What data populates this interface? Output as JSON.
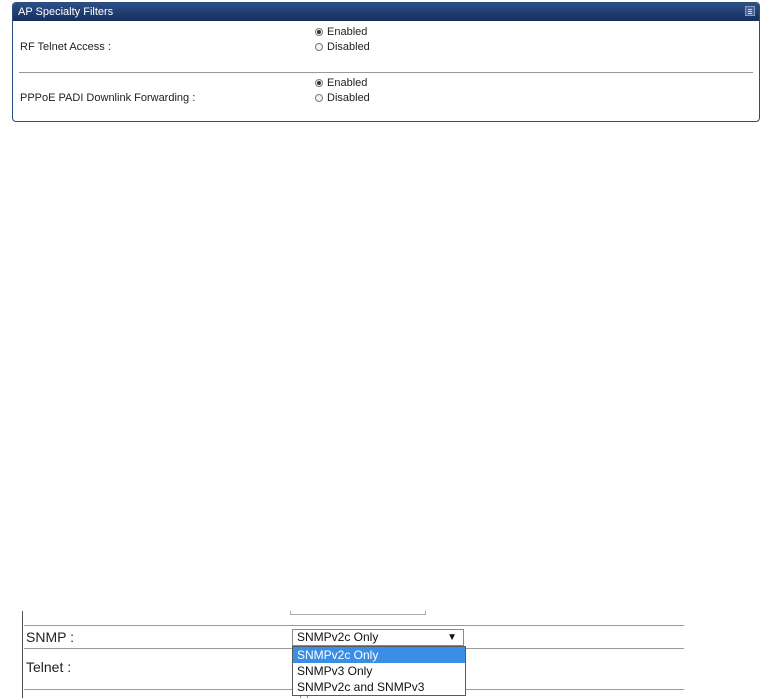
{
  "panel": {
    "title": "AP Specialty Filters",
    "rows": [
      {
        "label": "RF Telnet Access :",
        "options": [
          "Enabled",
          "Disabled"
        ],
        "selected": "Enabled"
      },
      {
        "label": "PPPoE PADI Downlink Forwarding :",
        "options": [
          "Enabled",
          "Disabled"
        ],
        "selected": "Enabled"
      }
    ]
  },
  "snmp_section": {
    "snmp_label": "SNMP :",
    "telnet_label": "Telnet :",
    "select_value": "SNMPv2c Only",
    "dropdown_arrow": "▼",
    "dropdown_options": [
      "SNMPv2c Only",
      "SNMPv3 Only",
      "SNMPv2c and SNMPv3"
    ],
    "highlighted_option": "SNMPv2c Only",
    "highlight_color": "#3a8ee6"
  },
  "colors": {
    "panel_header": "#1e3a6e",
    "panel_border": "#2b4c7e"
  }
}
